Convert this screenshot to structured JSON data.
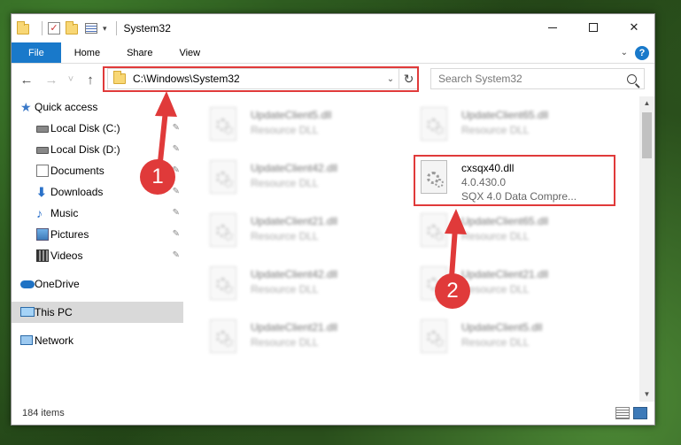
{
  "window": {
    "title": "System32",
    "controls": {
      "minimize": "—",
      "maximize": "",
      "close": "✕"
    }
  },
  "ribbon": {
    "tabs": [
      "File",
      "Home",
      "Share",
      "View"
    ],
    "help": "?"
  },
  "navigation": {
    "back": "←",
    "forward": "→",
    "recent": "˅",
    "up": "↑",
    "address": "C:\\Windows\\System32",
    "search_placeholder": "Search System32"
  },
  "sidebar": {
    "items": [
      {
        "label": "Quick access",
        "icon": "star-icon",
        "pinned": false
      },
      {
        "label": "Local Disk (C:)",
        "icon": "disk-icon",
        "pinned": true
      },
      {
        "label": "Local Disk (D:)",
        "icon": "disk-icon",
        "pinned": true
      },
      {
        "label": "Documents",
        "icon": "documents-icon",
        "pinned": true
      },
      {
        "label": "Downloads",
        "icon": "download-icon",
        "pinned": true
      },
      {
        "label": "Music",
        "icon": "music-icon",
        "pinned": true
      },
      {
        "label": "Pictures",
        "icon": "pictures-icon",
        "pinned": true
      },
      {
        "label": "Videos",
        "icon": "videos-icon",
        "pinned": true
      },
      {
        "label": "OneDrive",
        "icon": "onedrive-icon",
        "pinned": false
      },
      {
        "label": "This PC",
        "icon": "this-pc-icon",
        "pinned": false,
        "selected": true
      },
      {
        "label": "Network",
        "icon": "network-icon",
        "pinned": false
      }
    ]
  },
  "files": [
    {
      "name": "UpdateClient5.dll",
      "desc": "Resource DLL"
    },
    {
      "name": "UpdateClient65.dll",
      "desc": "Resource DLL"
    },
    {
      "name": "UpdateClient42.dll",
      "desc": "Resource DLL"
    },
    {
      "name": "cxsqx40.dll",
      "desc": "4.0.430.0",
      "desc2": "SQX 4.0 Data Compre..."
    },
    {
      "name": "UpdateClient21.dll",
      "desc": "Resource DLL"
    },
    {
      "name": "UpdateClient65.dll",
      "desc": "Resource DLL"
    },
    {
      "name": "UpdateClient42.dll",
      "desc": "Resource DLL"
    },
    {
      "name": "UpdateClient21.dll",
      "desc": "Resource DLL"
    },
    {
      "name": "UpdateClient21.dll",
      "desc": "Resource DLL"
    },
    {
      "name": "UpdateClient5.dll",
      "desc": "Resource DLL"
    }
  ],
  "status": {
    "count": "184 items"
  },
  "annotations": {
    "callout_1": "1",
    "callout_2": "2",
    "color": "#e03a3a"
  }
}
